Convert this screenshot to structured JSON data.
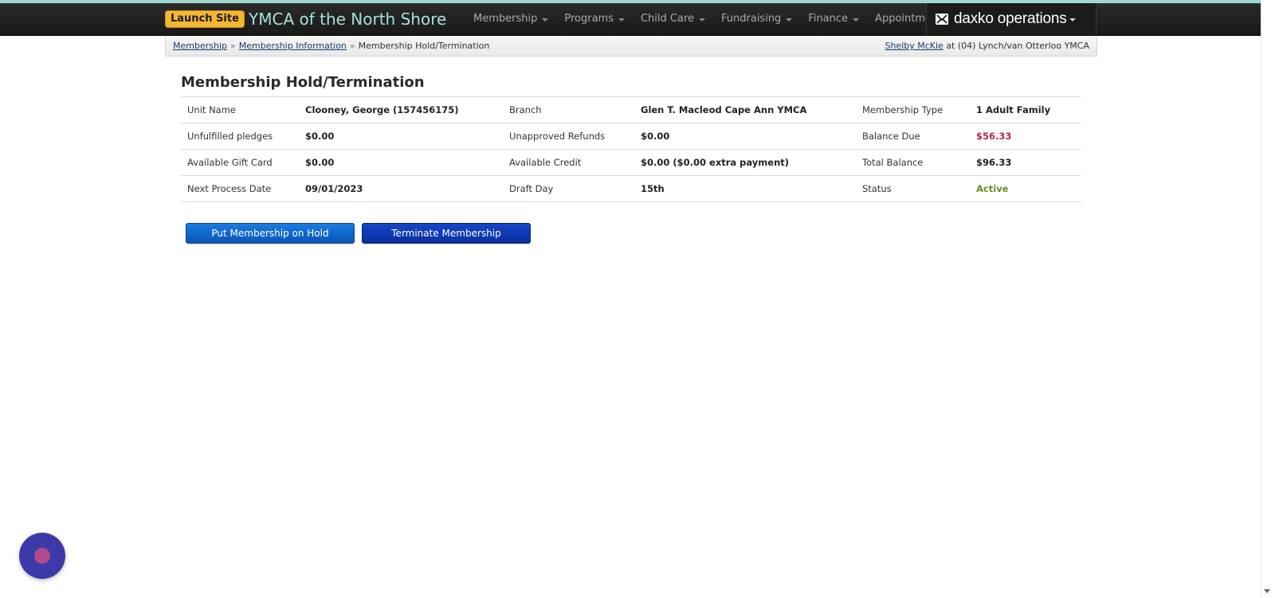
{
  "navbar": {
    "launch_label": "Launch Site",
    "site_title": "YMCA of the North Shore",
    "menu": [
      {
        "label": "Membership"
      },
      {
        "label": "Programs"
      },
      {
        "label": "Child Care"
      },
      {
        "label": "Fundraising"
      },
      {
        "label": "Finance"
      },
      {
        "label": "Appointments"
      }
    ],
    "brand": "daxko operations"
  },
  "breadcrumb": {
    "items": [
      "Membership",
      "Membership Information"
    ],
    "current": "Membership Hold/Termination",
    "separator": "»"
  },
  "user": {
    "name": "Shelby McKie",
    "connector": "at",
    "location": "(04) Lynch/van Otterloo YMCA"
  },
  "page": {
    "title": "Membership Hold/Termination"
  },
  "info_rows": [
    [
      {
        "label": "Unit Name",
        "value": "Clooney, George (157456175)"
      },
      {
        "label": "Branch",
        "value": "Glen T. Macleod Cape Ann YMCA"
      },
      {
        "label": "Membership Type",
        "value": "1 Adult Family"
      }
    ],
    [
      {
        "label": "Unfulfilled pledges",
        "value": "$0.00"
      },
      {
        "label": "Unapproved Refunds",
        "value": "$0.00"
      },
      {
        "label": "Balance Due",
        "value": "$56.33"
      }
    ],
    [
      {
        "label": "Available Gift Card",
        "value": "$0.00"
      },
      {
        "label": "Available Credit",
        "value": "$0.00 ($0.00 extra payment)"
      },
      {
        "label": "Total Balance",
        "value": "$96.33"
      }
    ],
    [
      {
        "label": "Next Process Date",
        "value": "09/01/2023"
      },
      {
        "label": "Draft Day",
        "value": "15th"
      },
      {
        "label": "Status",
        "value": "Active"
      }
    ]
  ],
  "actions": {
    "hold_label": "Put Membership on Hold",
    "terminate_label": "Terminate Membership"
  },
  "colors": {
    "balance_due": "#b0245a",
    "status_active": "#6b8e23",
    "launch_button": "#f2b632",
    "site_title": "#a7e0d8"
  },
  "icons": {
    "brand": "envelope-icon",
    "chat": "chat-widget-icon"
  }
}
